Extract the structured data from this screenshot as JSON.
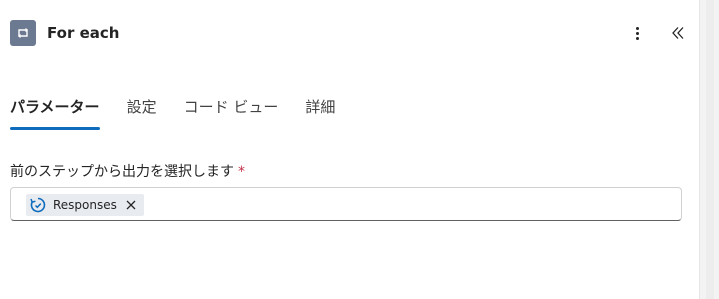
{
  "header": {
    "title": "For each",
    "action_icon": "loop-icon",
    "action_icon_color": "#6b7a90",
    "more_icon": "more-vertical-icon",
    "collapse_icon": "double-chevron-left-icon"
  },
  "tabs": [
    {
      "label": "パラメーター",
      "active": true
    },
    {
      "label": "設定",
      "active": false
    },
    {
      "label": "コード ビュー",
      "active": false
    },
    {
      "label": "詳細",
      "active": false
    }
  ],
  "field": {
    "label": "前のステップから出力を選択します",
    "required_marker": "*",
    "token": {
      "label": "Responses",
      "icon": "forms-refresh-icon",
      "remove_icon": "close-icon"
    }
  },
  "colors": {
    "accent": "#0f6cbd",
    "required": "#c4314b",
    "token_bg": "#e8ebf0"
  }
}
